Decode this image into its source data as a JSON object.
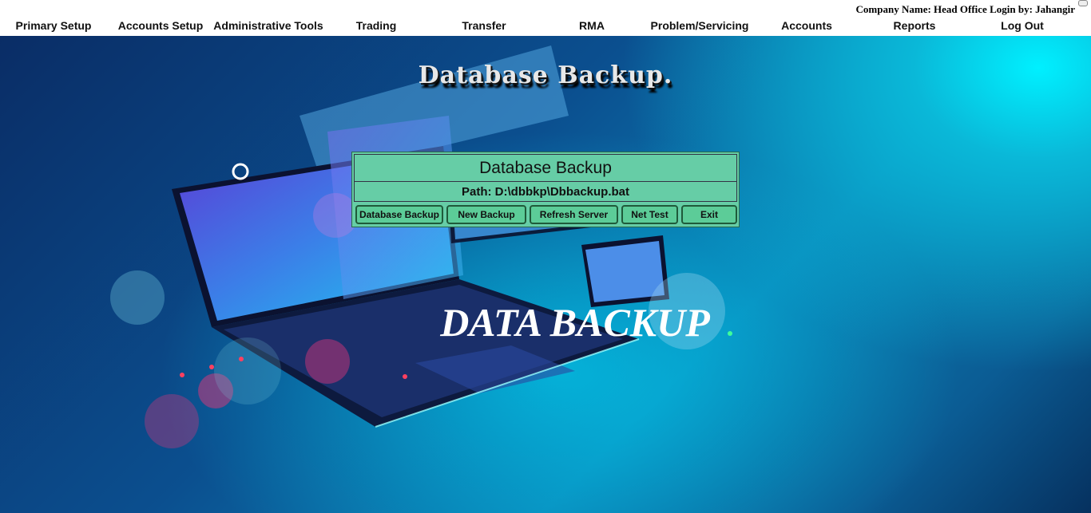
{
  "header": {
    "company_line": "Company Name: Head Office Login by: Jahangir",
    "menu": [
      {
        "label": "Primary Setup"
      },
      {
        "label": "Accounts Setup"
      },
      {
        "label": "Administrative Tools"
      },
      {
        "label": "Trading"
      },
      {
        "label": "Transfer"
      },
      {
        "label": "RMA"
      },
      {
        "label": "Problem/Servicing"
      },
      {
        "label": "Accounts"
      },
      {
        "label": "Reports"
      },
      {
        "label": "Log Out"
      }
    ]
  },
  "page": {
    "heading": "Database Backup.",
    "background_caption": "DATA BACKUP"
  },
  "dialog": {
    "title": "Database Backup",
    "path": "Path: D:\\dbbkp\\Dbbackup.bat",
    "buttons": [
      {
        "label": "Database Backup"
      },
      {
        "label": "New Backup"
      },
      {
        "label": "Refresh Server"
      },
      {
        "label": "Net Test"
      },
      {
        "label": "Exit"
      }
    ]
  },
  "colors": {
    "dialog_bg": "#66cda6",
    "button_bg": "#5ccc98",
    "stage_dark": "#0a2d66",
    "stage_glow": "#00f0ff"
  }
}
